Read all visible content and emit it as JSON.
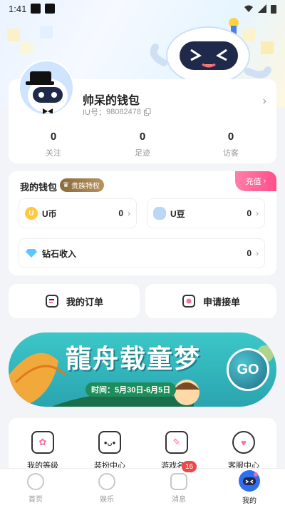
{
  "status_bar": {
    "time": "1:41"
  },
  "profile": {
    "name": "帅呆的钱包",
    "uid_label": "IU号：",
    "uid": "98082478",
    "stats": [
      {
        "value": "0",
        "label": "关注"
      },
      {
        "value": "0",
        "label": "足迹"
      },
      {
        "value": "0",
        "label": "访客"
      }
    ]
  },
  "wallet": {
    "title": "我的钱包",
    "vip_badge": "贵族特权",
    "recharge": "充值",
    "items": [
      {
        "label": "U币",
        "value": "0"
      },
      {
        "label": "U豆",
        "value": "0"
      },
      {
        "label": "钻石收入",
        "value": "0"
      }
    ]
  },
  "orders": {
    "my_orders": "我的订单",
    "apply": "申请接单"
  },
  "banner": {
    "title": "龍舟载童梦",
    "date": "时间：5月30日-6月5日",
    "go": "GO"
  },
  "services": [
    {
      "label": "我的等级"
    },
    {
      "label": "装扮中心"
    },
    {
      "label": "游戏名片"
    },
    {
      "label": "客服中心"
    }
  ],
  "tabs": [
    {
      "label": "首页"
    },
    {
      "label": "娱乐"
    },
    {
      "label": "消息"
    },
    {
      "label": "我的"
    }
  ],
  "message_badge": "16",
  "colors": {
    "accent": "#ff4f8b",
    "primary": "#2e6ff2",
    "banner": "#2aa4b0"
  }
}
